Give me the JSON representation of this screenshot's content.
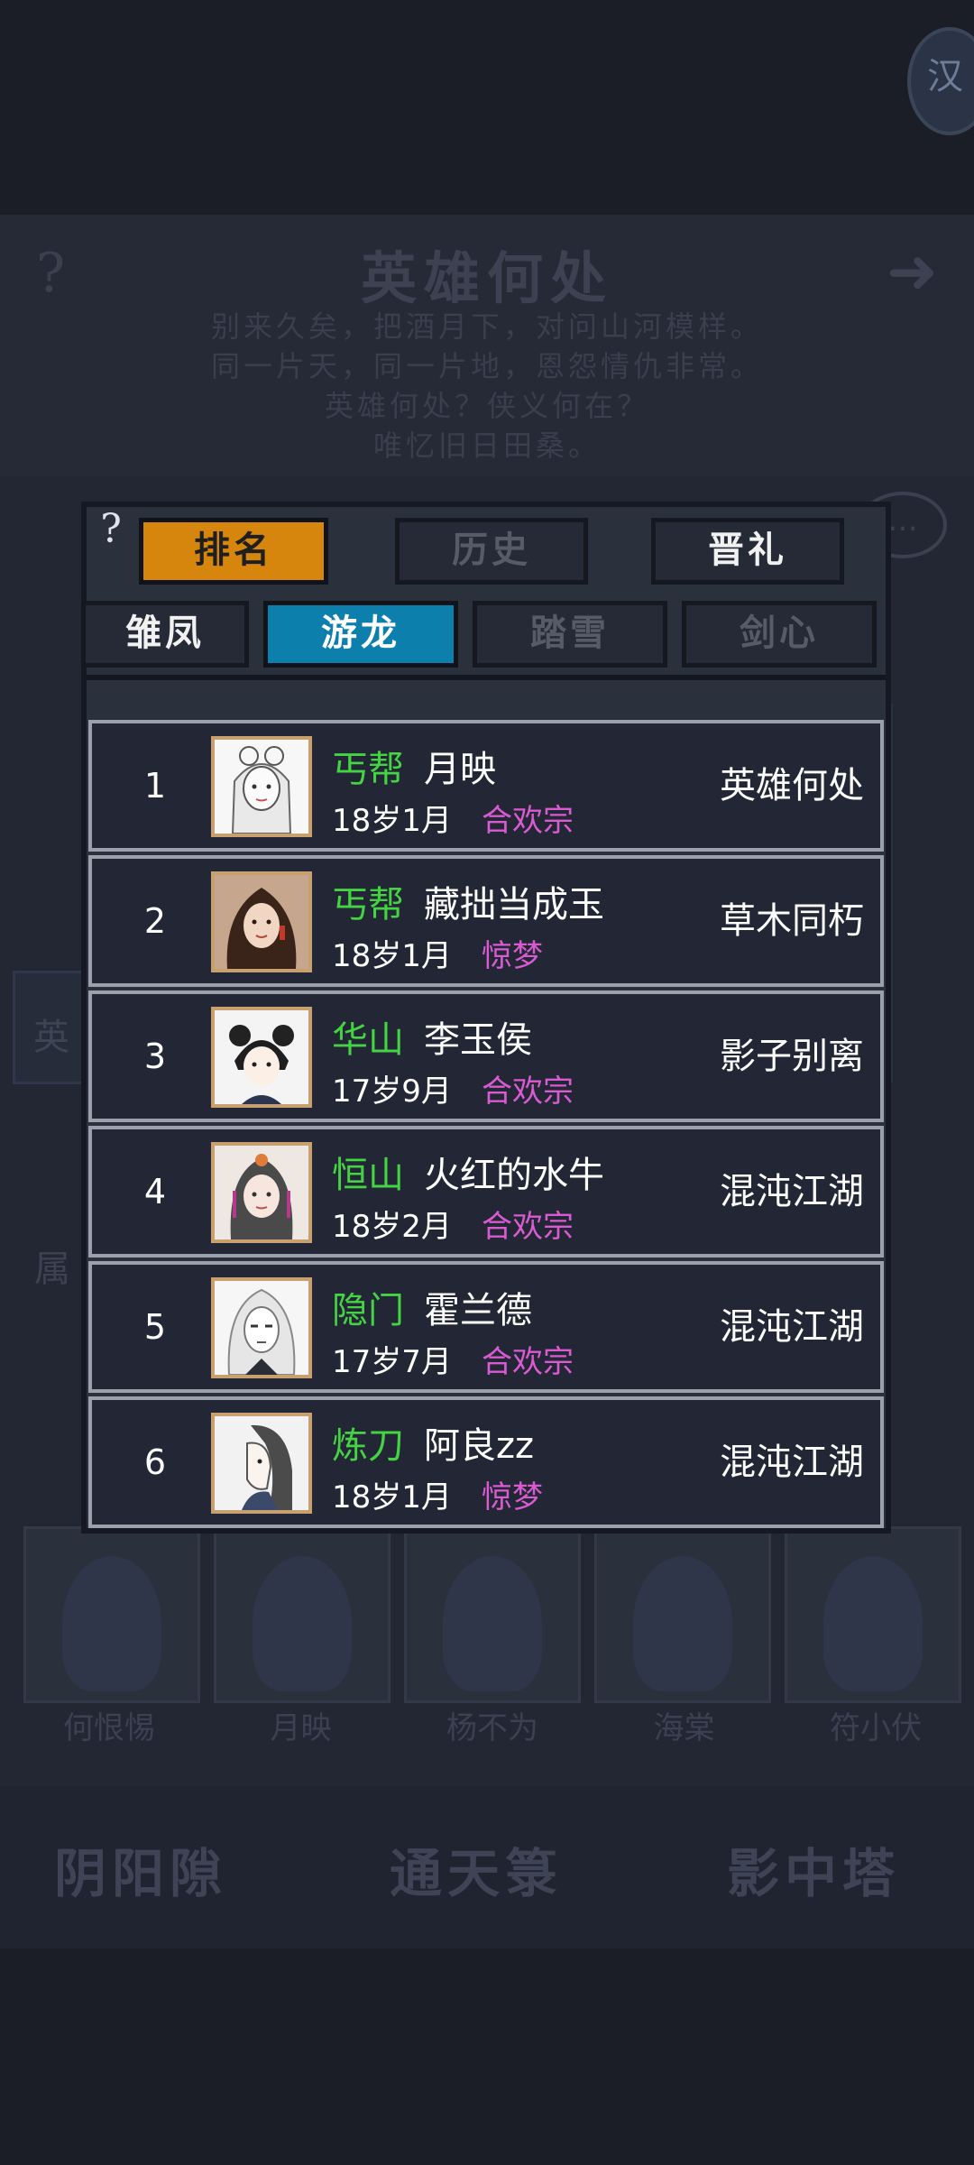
{
  "background": {
    "badge_glyph": "汉",
    "help": "?",
    "title": "英雄何处",
    "arrow": "➜",
    "poem": [
      "别来久矣，把酒月下，对问山河模样。",
      "同一片天，同一片地，恩怨情仇非常。",
      "英雄何处？侠义何在？",
      "唯忆旧日田桑。"
    ],
    "bubble": "…",
    "side_label": "英",
    "shu": "属",
    "portraits": [
      "何恨惕",
      "月映",
      "杨不为",
      "海棠",
      "符小伏"
    ],
    "nav": [
      "阴阳隙",
      "通天箓",
      "影中塔"
    ]
  },
  "dialog": {
    "help": "?",
    "top_tabs": [
      "排名",
      "历史",
      "晋礼"
    ],
    "sub_tabs": [
      "雏凤",
      "游龙",
      "踏雪",
      "剑心"
    ]
  },
  "ranking": [
    {
      "rank": "1",
      "sect": "丐帮",
      "name": "月映",
      "age": "18岁1月",
      "school": "合欢宗",
      "title": "英雄何处"
    },
    {
      "rank": "2",
      "sect": "丐帮",
      "name": "藏拙当成玉",
      "age": "18岁1月",
      "school": "惊梦",
      "title": "草木同朽"
    },
    {
      "rank": "3",
      "sect": "华山",
      "name": "李玉侯",
      "age": "17岁9月",
      "school": "合欢宗",
      "title": "影子别离"
    },
    {
      "rank": "4",
      "sect": "恒山",
      "name": "火红的水牛",
      "age": "18岁2月",
      "school": "合欢宗",
      "title": "混沌江湖"
    },
    {
      "rank": "5",
      "sect": "隐门",
      "name": "霍兰德",
      "age": "17岁7月",
      "school": "合欢宗",
      "title": "混沌江湖"
    },
    {
      "rank": "6",
      "sect": "炼刀",
      "name": "阿良zz",
      "age": "18岁1月",
      "school": "惊梦",
      "title": "混沌江湖"
    }
  ],
  "colors": {
    "sect": "#43d343",
    "school": "#d95bd1",
    "tab_active_orange": "#d6860c",
    "tab_active_blue": "#0c7fad"
  }
}
